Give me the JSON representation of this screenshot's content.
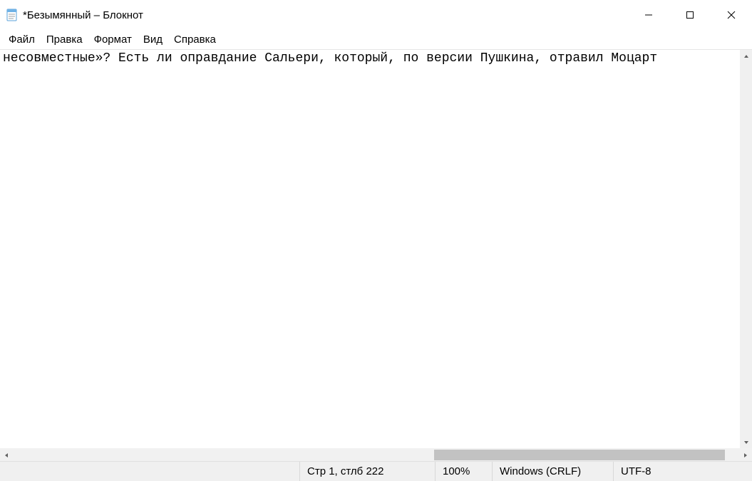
{
  "title": "*Безымянный – Блокнот",
  "menu": {
    "file": "Файл",
    "edit": "Правка",
    "format": "Формат",
    "view": "Вид",
    "help": "Справка"
  },
  "editor": {
    "content": "несовместные»? Есть ли оправдание Сальери, который, по версии Пушкина, отравил Моцарт"
  },
  "status": {
    "position": "Стр 1, стлб 222",
    "zoom": "100%",
    "eol": "Windows (CRLF)",
    "encoding": "UTF-8"
  }
}
